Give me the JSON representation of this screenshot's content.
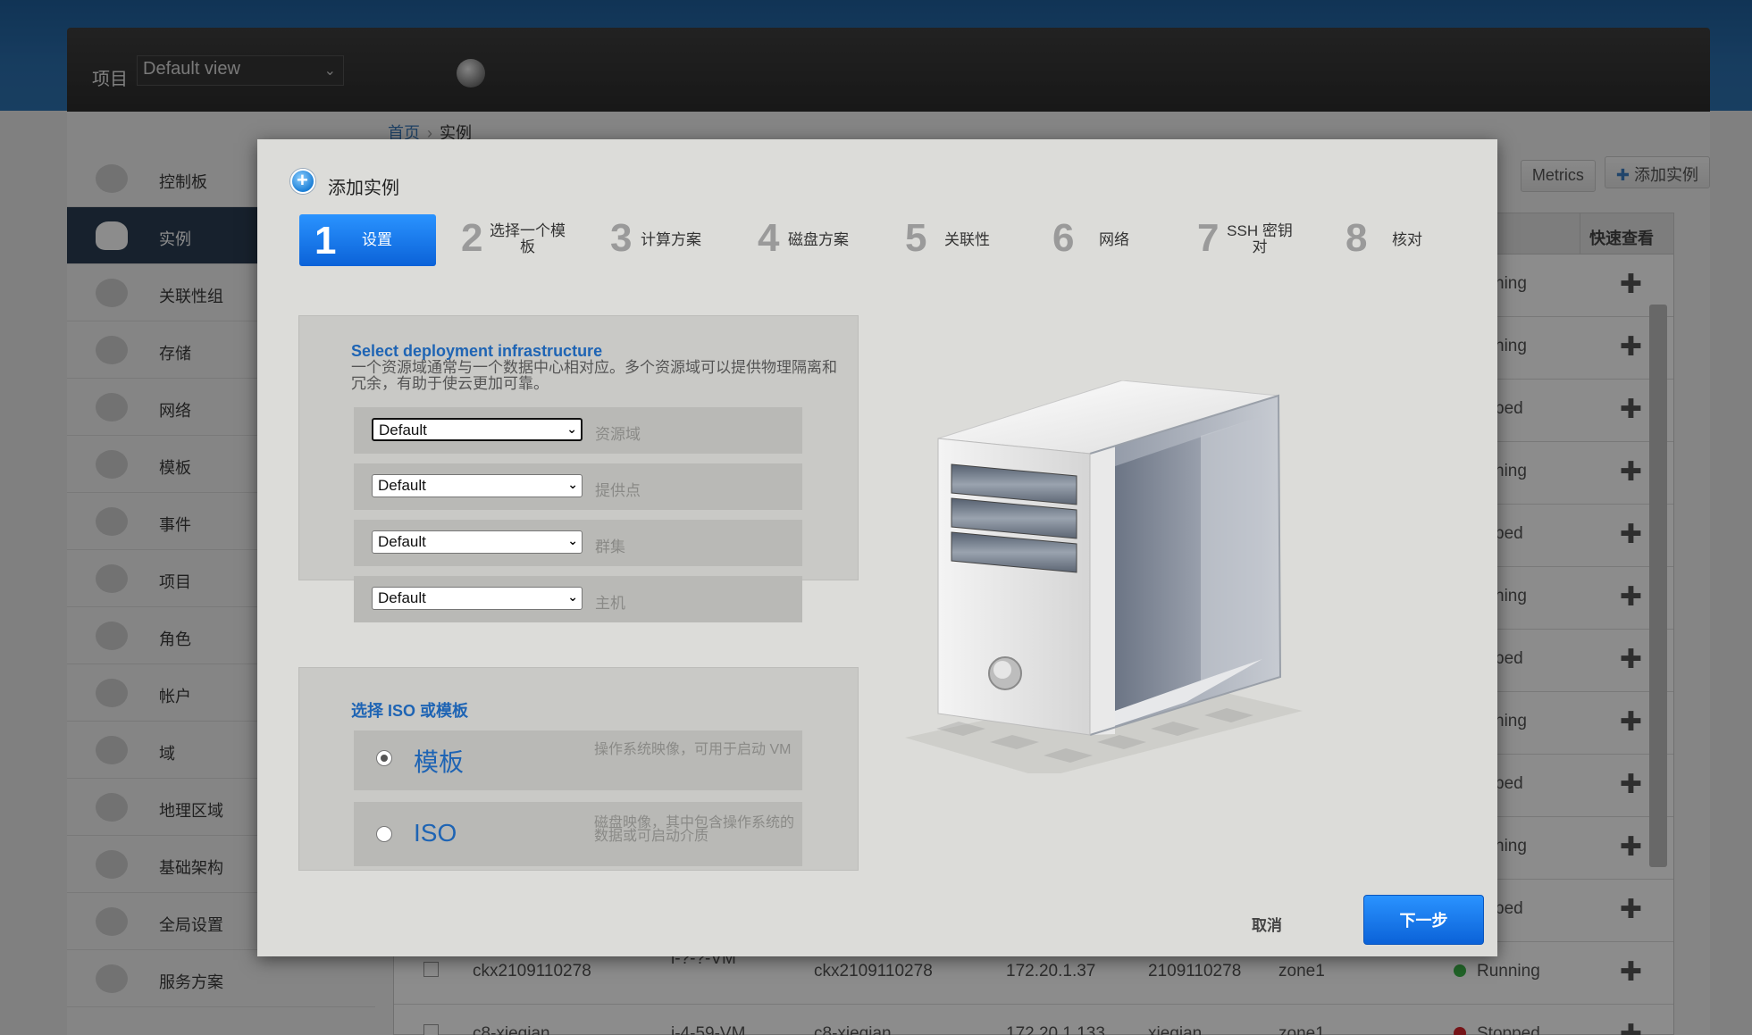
{
  "header": {
    "project_label": "项目",
    "project_value": "Default view"
  },
  "sidebar": {
    "items": [
      {
        "label": "控制板",
        "icon": "dashboard-icon"
      },
      {
        "label": "实例",
        "icon": "cloud-icon",
        "active": true
      },
      {
        "label": "关联性组",
        "icon": "cloud-sync-icon"
      },
      {
        "label": "存储",
        "icon": "storage-icon"
      },
      {
        "label": "网络",
        "icon": "network-icon"
      },
      {
        "label": "模板",
        "icon": "template-icon"
      },
      {
        "label": "事件",
        "icon": "calendar-icon"
      },
      {
        "label": "项目",
        "icon": "folder-icon"
      },
      {
        "label": "角色",
        "icon": "roles-icon"
      },
      {
        "label": "帐户",
        "icon": "user-icon"
      },
      {
        "label": "域",
        "icon": "domain-icon"
      },
      {
        "label": "地理区域",
        "icon": "globe-icon"
      },
      {
        "label": "基础架构",
        "icon": "infrastructure-icon"
      },
      {
        "label": "全局设置",
        "icon": "globe-settings-icon"
      },
      {
        "label": "服务方案",
        "icon": "gear-icon"
      }
    ]
  },
  "breadcrumb": {
    "home": "首页",
    "current": "实例"
  },
  "toolbar": {
    "metrics_label": "Metrics",
    "add_label": "添加实例"
  },
  "grid": {
    "quickview_header": "快速查看",
    "status_fragments": [
      "ning",
      "ning",
      "ped",
      "ning",
      "ped",
      "ning",
      "ped",
      "ning",
      "ped",
      "ning",
      "ped"
    ],
    "rows": [
      {
        "name": "ckx2109110278",
        "internal": "i-?-?-VM",
        "display": "ckx2109110278",
        "ip": "172.20.1.37",
        "account": "2109110278",
        "zone": "zone1",
        "state": "Running",
        "state_color": "#3cb64a"
      },
      {
        "name": "c8-xieqian",
        "internal": "i-4-59-VM",
        "display": "c8-xieqian",
        "ip": "172.20.1.133",
        "account": "xieqian",
        "zone": "zone1",
        "state": "Stopped",
        "state_color": "#d8262c"
      }
    ]
  },
  "modal": {
    "title": "添加实例",
    "steps": [
      {
        "num": "1",
        "label": "设置",
        "active": true
      },
      {
        "num": "2",
        "label": "选择一个模板"
      },
      {
        "num": "3",
        "label": "计算方案"
      },
      {
        "num": "4",
        "label": "磁盘方案"
      },
      {
        "num": "5",
        "label": "关联性"
      },
      {
        "num": "6",
        "label": "网络"
      },
      {
        "num": "7",
        "label": "SSH 密钥对"
      },
      {
        "num": "8",
        "label": "核对"
      }
    ],
    "infra": {
      "title": "Select deployment infrastructure",
      "description": "一个资源域通常与一个数据中心相对应。多个资源域可以提供物理隔离和冗余，有助于使云更加可靠。",
      "fields": [
        {
          "value": "Default",
          "label": "资源域"
        },
        {
          "value": "Default",
          "label": "提供点"
        },
        {
          "value": "Default",
          "label": "群集"
        },
        {
          "value": "Default",
          "label": "主机"
        }
      ]
    },
    "source": {
      "title": "选择 ISO 或模板",
      "options": [
        {
          "title": "模板",
          "desc": "操作系统映像，可用于启动 VM",
          "checked": true
        },
        {
          "title": "ISO",
          "desc": "磁盘映像，其中包含操作系统的数据或可启动介质",
          "checked": false
        }
      ]
    },
    "cancel_label": "取消",
    "next_label": "下一步"
  },
  "colors": {
    "accent": "#1e64b4",
    "primary_button": "#0b62d8",
    "running": "#3cb64a",
    "stopped": "#d8262c"
  }
}
